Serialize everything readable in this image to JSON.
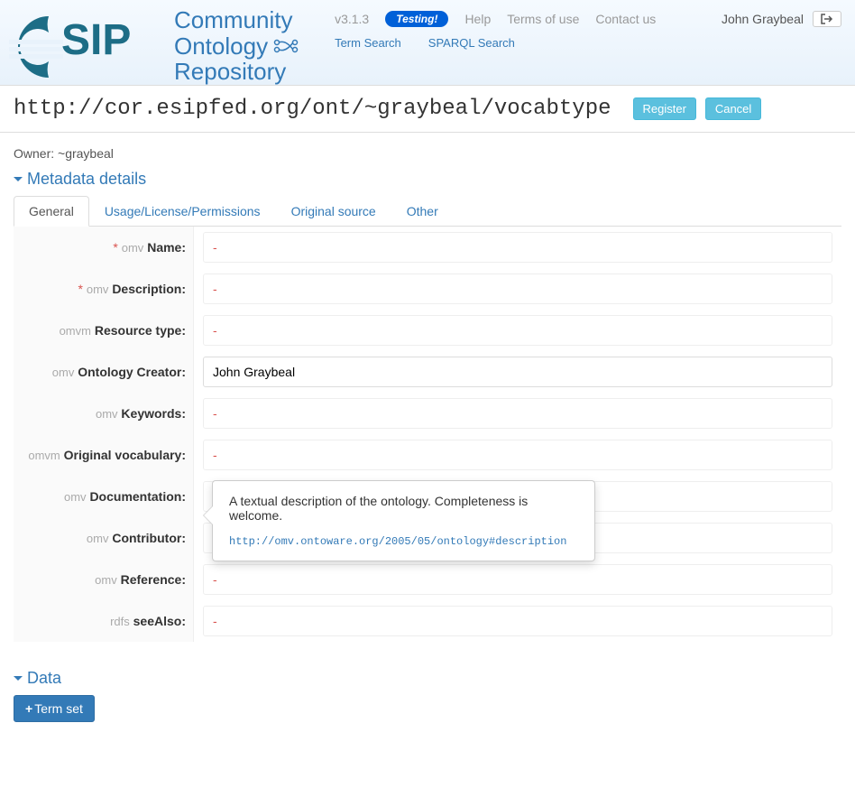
{
  "header": {
    "logo_line1": "Community",
    "logo_line2": "Ontology",
    "logo_line3": "Repository",
    "version": "v3.1.3",
    "testing_badge": "Testing!",
    "nav1": {
      "help": "Help",
      "terms": "Terms of use",
      "contact": "Contact us"
    },
    "nav2": {
      "term_search": "Term Search",
      "sparql_search": "SPARQL Search"
    },
    "user": "John Graybeal"
  },
  "url_bar": {
    "url": "http://cor.esipfed.org/ont/~graybeal/vocabtype",
    "register": "Register",
    "cancel": "Cancel"
  },
  "owner_line": "Owner: ~graybeal",
  "sections": {
    "metadata": "Metadata details",
    "data": "Data"
  },
  "tabs": {
    "general": "General",
    "usage": "Usage/License/Permissions",
    "original": "Original source",
    "other": "Other"
  },
  "fields": [
    {
      "required": true,
      "prefix": "omv",
      "label": "Name:",
      "value": ""
    },
    {
      "required": true,
      "prefix": "omv",
      "label": "Description:",
      "value": ""
    },
    {
      "required": false,
      "prefix": "omvm",
      "label": "Resource type:",
      "value": ""
    },
    {
      "required": false,
      "prefix": "omv",
      "label": "Ontology Creator:",
      "value": "John Graybeal"
    },
    {
      "required": false,
      "prefix": "omv",
      "label": "Keywords:",
      "value": ""
    },
    {
      "required": false,
      "prefix": "omvm",
      "label": "Original vocabulary:",
      "value": ""
    },
    {
      "required": false,
      "prefix": "omv",
      "label": "Documentation:",
      "value": ""
    },
    {
      "required": false,
      "prefix": "omv",
      "label": "Contributor:",
      "value": ""
    },
    {
      "required": false,
      "prefix": "omv",
      "label": "Reference:",
      "value": ""
    },
    {
      "required": false,
      "prefix": "rdfs",
      "label": "seeAlso:",
      "value": ""
    }
  ],
  "placeholder_dash": "-",
  "tooltip": {
    "text": "A textual description of the ontology. Completeness is welcome.",
    "link": "http://omv.ontoware.org/2005/05/ontology#description"
  },
  "data_section": {
    "term_set_btn": "Term set"
  }
}
